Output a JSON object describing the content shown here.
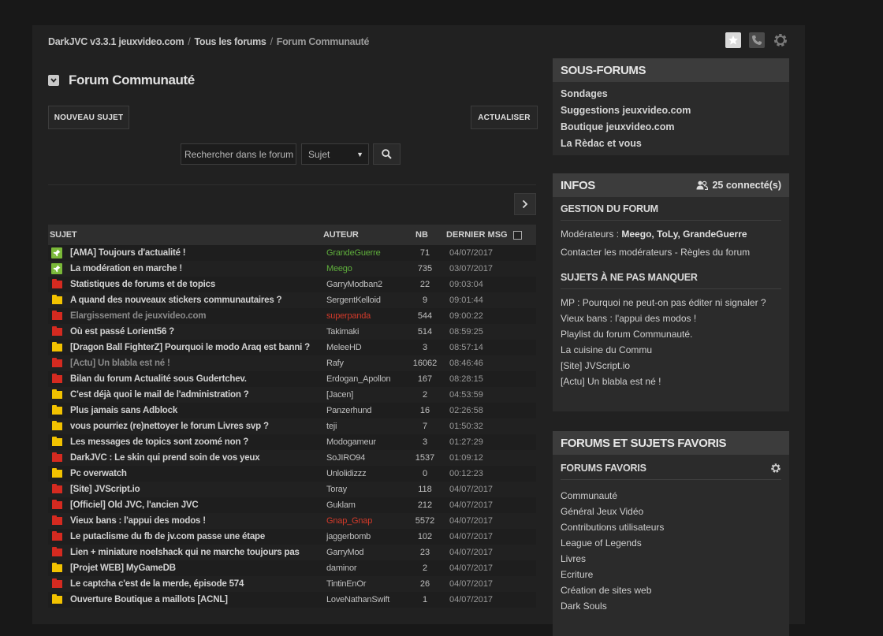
{
  "breadcrumb": {
    "version": "DarkJVC v3.3.1",
    "site": "jeuxvideo.com",
    "all_forums": "Tous les forums",
    "current": "Forum Communauté",
    "sep": "/"
  },
  "forum": {
    "title": "Forum Communauté",
    "new_topic_label": "NOUVEAU SUJET",
    "refresh_label": "ACTUALISER",
    "search_placeholder": "Rechercher dans le forum",
    "search_type": "Sujet"
  },
  "table": {
    "headers": {
      "subject": "SUJET",
      "author": "AUTEUR",
      "nb": "NB",
      "last": "DERNIER MSG"
    },
    "rows": [
      {
        "icon": "pinned-icon",
        "subject": "[AMA] Toujours d'actualité !",
        "author": "GrandeGuerre",
        "author_color": "#5fae3c",
        "nb": "71",
        "last": "04/07/2017"
      },
      {
        "icon": "pinned-icon",
        "subject": "La modération en marche !",
        "author": "Meego",
        "author_color": "#5fae3c",
        "nb": "735",
        "last": "03/07/2017"
      },
      {
        "icon": "red-folder-icon",
        "subject": "Statistiques de forums et de topics",
        "author": "GarryModban2",
        "nb": "22",
        "last": "09:03:04"
      },
      {
        "icon": "yellow-folder-icon",
        "subject": "A quand des nouveaux stickers communautaires ?",
        "author": "SergentKelloid",
        "nb": "9",
        "last": "09:01:44"
      },
      {
        "icon": "red-folder-icon",
        "subject": "Élargissement de jeuxvideo.com",
        "author": "superpanda",
        "author_color": "#d23a2a",
        "nb": "544",
        "last": "09:00:22",
        "faded": true
      },
      {
        "icon": "red-folder-icon",
        "subject": "Où est passé Lorient56 ?",
        "author": "Takimaki",
        "nb": "514",
        "last": "08:59:25"
      },
      {
        "icon": "yellow-folder-icon",
        "subject": "[Dragon Ball FighterZ] Pourquoi le modo Araq est banni ?",
        "author": "MeleeHD",
        "nb": "3",
        "last": "08:57:14"
      },
      {
        "icon": "red-folder-icon",
        "subject": "[Actu] Un blabla est né !",
        "author": "Rafy",
        "nb": "16062",
        "last": "08:46:46",
        "faded": true
      },
      {
        "icon": "red-folder-icon",
        "subject": "Bilan du forum Actualité sous Gudertchev.",
        "author": "Erdogan_Apollon",
        "nb": "167",
        "last": "08:28:15"
      },
      {
        "icon": "yellow-folder-icon",
        "subject": "C'est déjà quoi le mail de l'administration ?",
        "author": "[Jacen]",
        "nb": "2",
        "last": "04:53:59"
      },
      {
        "icon": "yellow-folder-icon",
        "subject": "Plus jamais sans Adblock",
        "author": "Panzerhund",
        "nb": "16",
        "last": "02:26:58"
      },
      {
        "icon": "yellow-folder-icon",
        "subject": "vous pourriez (re)nettoyer le forum Livres svp ?",
        "author": "teji",
        "nb": "7",
        "last": "01:50:32"
      },
      {
        "icon": "yellow-folder-icon",
        "subject": "Les messages de topics sont zoomé non ?",
        "author": "Modogameur",
        "nb": "3",
        "last": "01:27:29"
      },
      {
        "icon": "red-folder-icon",
        "subject": "DarkJVC : Le skin qui prend soin de vos yeux",
        "author": "SoJIRO94",
        "nb": "1537",
        "last": "01:09:12"
      },
      {
        "icon": "yellow-folder-icon",
        "subject": "Pc overwatch",
        "author": "Unlolidizzz",
        "nb": "0",
        "last": "00:12:23"
      },
      {
        "icon": "red-folder-icon",
        "subject": "[Site] JVScript.io",
        "author": "Toray",
        "nb": "118",
        "last": "04/07/2017"
      },
      {
        "icon": "red-folder-icon",
        "subject": "[Officiel] Old JVC, l'ancien JVC",
        "author": "Guklam",
        "nb": "212",
        "last": "04/07/2017"
      },
      {
        "icon": "red-folder-icon",
        "subject": "Vieux bans : l'appui des modos !",
        "author": "Gnap_Gnap",
        "author_color": "#d23a2a",
        "nb": "5572",
        "last": "04/07/2017"
      },
      {
        "icon": "red-folder-icon",
        "subject": "Le putaclisme du fb de jv.com passe une étape",
        "author": "jaggerbomb",
        "nb": "102",
        "last": "04/07/2017"
      },
      {
        "icon": "red-folder-icon",
        "subject": "Lien + miniature noelshack qui ne marche toujours pas",
        "author": "GarryMod",
        "nb": "23",
        "last": "04/07/2017"
      },
      {
        "icon": "yellow-folder-icon",
        "subject": "[Projet WEB] MyGameDB",
        "author": "daminor",
        "nb": "2",
        "last": "04/07/2017"
      },
      {
        "icon": "red-folder-icon",
        "subject": "Le captcha c'est de la merde, épisode 574",
        "author": "TintinEnOr",
        "nb": "26",
        "last": "04/07/2017"
      },
      {
        "icon": "yellow-folder-icon",
        "subject": "Ouverture Boutique a maillots [ACNL]",
        "author": "LoveNathanSwift",
        "nb": "1",
        "last": "04/07/2017"
      }
    ]
  },
  "subforums": {
    "title": "SOUS-FORUMS",
    "items": [
      "Sondages",
      "Suggestions jeuxvideo.com",
      "Boutique jeuxvideo.com",
      "La Rèdac et vous"
    ]
  },
  "infos": {
    "title": "INFOS",
    "connected": "25 connecté(s)",
    "management_title": "GESTION DU FORUM",
    "moderators_label": "Modérateurs :",
    "moderators": "Meego, ToLy, GrandeGuerre",
    "contact": "Contacter les modérateurs",
    "contact_sep": "-",
    "rules": "Règles du forum",
    "must_title": "SUJETS À NE PAS MANQUER",
    "must_items": [
      "MP : Pourquoi ne peut-on pas éditer ni signaler ?",
      "Vieux bans : l'appui des modos !",
      "Playlist du forum Communauté.",
      "La cuisine du Commu",
      "[Site] JVScript.io",
      "[Actu] Un blabla est né !"
    ]
  },
  "favorites": {
    "title": "FORUMS ET SUJETS FAVORIS",
    "forums_title": "FORUMS FAVORIS",
    "items": [
      "Communauté",
      "Général Jeux Vidéo",
      "Contributions utilisateurs",
      "League of Legends",
      "Livres",
      "Ecriture",
      "Création de sites web",
      "Dark Souls"
    ]
  },
  "colors": {
    "accent_green": "#7ab838",
    "folder_red": "#d52a20",
    "folder_yellow": "#f2c200",
    "background": "#181818"
  }
}
